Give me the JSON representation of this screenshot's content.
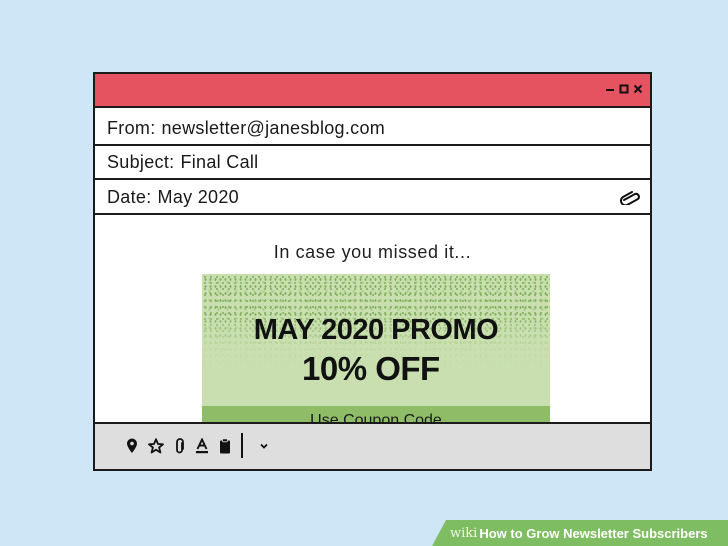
{
  "window": {
    "controls": {
      "minimize_icon": "minimize-icon",
      "maximize_icon": "maximize-icon",
      "close_icon": "close-icon"
    },
    "titlebar_color": "#e4535f"
  },
  "email": {
    "from_label": "From:",
    "from_value": "newsletter@janesblog.com",
    "subject_label": "Subject:",
    "subject_value": "Final Call",
    "date_label": "Date:",
    "date_value": "May 2020",
    "attachment_icon": "paperclip-icon",
    "intro": "In case you missed it...",
    "promo": {
      "title": "MAY 2020 PROMO",
      "discount": "10% OFF",
      "coupon_label": "Use Coupon Code"
    }
  },
  "toolbar": {
    "icons": [
      "map-pin-icon",
      "star-icon",
      "paperclip-icon",
      "font-color-icon",
      "clipboard-icon",
      "chevron-down-icon"
    ]
  },
  "caption": {
    "brand": "wiki",
    "how": "How",
    "rest": " to Grow Newsletter Subscribers"
  }
}
